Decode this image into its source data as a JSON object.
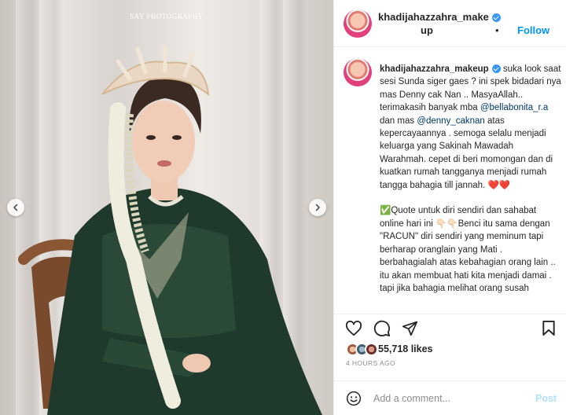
{
  "media": {
    "watermark": "SAY PHOTOGRAPHY"
  },
  "post": {
    "username_line1": "khadijahazzahra_make",
    "username_line2": "up",
    "follow_label": "Follow",
    "separator": "•",
    "more_label": "...",
    "caption_username": "khadijahazzahra_makeup",
    "caption": {
      "p1_a": " suka look saat sesi Sunda siger gaes ? ini spek bidadari nya mas Denny cak Nan .. MasyaAllah.. terimakasih banyak mba ",
      "mention1": "@bellabonita_r.a",
      "p1_b": " dan mas ",
      "mention2": "@denny_caknan",
      "p1_c": " atas kepercayaannya . semoga selalu menjadi keluarga yang Sakinah Mawadah Warahmah. cepet di beri momongan dan di kuatkan rumah tangganya menjadi rumah tangga bahagia till jannah. ",
      "hearts": "❤️❤️",
      "p2_check": "✅",
      "p2_a": "Quote untuk diri sendiri dan sahabat online hari ini ",
      "p2_hands": "👇🏻👇🏻",
      "p2_b": "Benci itu sama dengan \"RACUN\" diri sendiri yang meminum tapi berharap oranglain yang Mati . berbahagialah atas kebahagian orang lain .. itu akan membuat hati kita menjadi damai . tapi jika bahagia melihat orang susah"
    },
    "likes": "55,718 likes",
    "time_ago": "4 HOURS AGO",
    "comment_placeholder": "Add a comment...",
    "post_label": "Post"
  },
  "colors": {
    "accent": "#0095f6",
    "verified": "#3897f0",
    "post_disabled": "#b2dffc"
  }
}
